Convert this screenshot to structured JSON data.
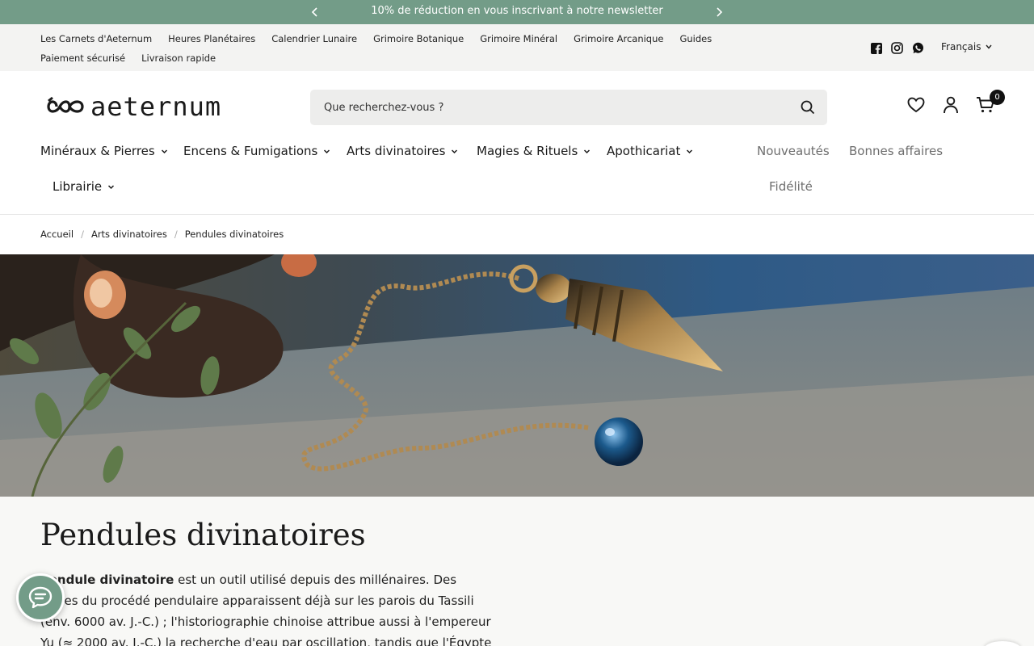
{
  "announcement": {
    "text": "10% de réduction en vous inscrivant à notre newsletter",
    "prev_icon": "chevron-left-icon",
    "next_icon": "chevron-right-icon"
  },
  "utility_nav": {
    "links": [
      "Les Carnets d'Aeternum",
      "Heures Planétaires",
      "Calendrier Lunaire",
      "Grimoire Botanique",
      "Grimoire Minéral",
      "Grimoire Arcanique",
      "Guides",
      "Paiement sécurisé",
      "Livraison rapide"
    ],
    "social_icons": [
      "facebook-icon",
      "instagram-icon",
      "whatsapp-icon"
    ],
    "language": "Français"
  },
  "header": {
    "logo_text": "aeternum",
    "search_placeholder": "Que recherchez-vous ?",
    "cart_count": "0"
  },
  "main_nav": {
    "menus": [
      "Minéraux & Pierres",
      "Encens & Fumigations",
      "Arts divinatoires",
      "Magies & Rituels",
      "Apothicariat",
      "Librairie"
    ],
    "side_links": [
      "Nouveautés",
      "Bonnes affaires",
      "Fidélité"
    ]
  },
  "breadcrumb": [
    "Accueil",
    "Arts divinatoires",
    "Pendules divinatoires"
  ],
  "page": {
    "title": "Pendules divinatoires",
    "intro_bold": "pendule divinatoire",
    "intro_rest": " est un outil utilisé depuis des millénaires. Des traces du procédé pendulaire apparaissent déjà sur les parois du Tassili (env. 6000 av. J.-C.) ; l'historiographie chinoise attribue aussi à l'empereur Yu (≈ 2000 av. J.-C.) la recherche d'eau par oscillation, tandis que l'Égypte et"
  },
  "colors": {
    "accent": "#739c88",
    "topbar_bg": "#f3f3f2",
    "search_bg": "#ededec",
    "content_bg": "#f8f8f6"
  }
}
